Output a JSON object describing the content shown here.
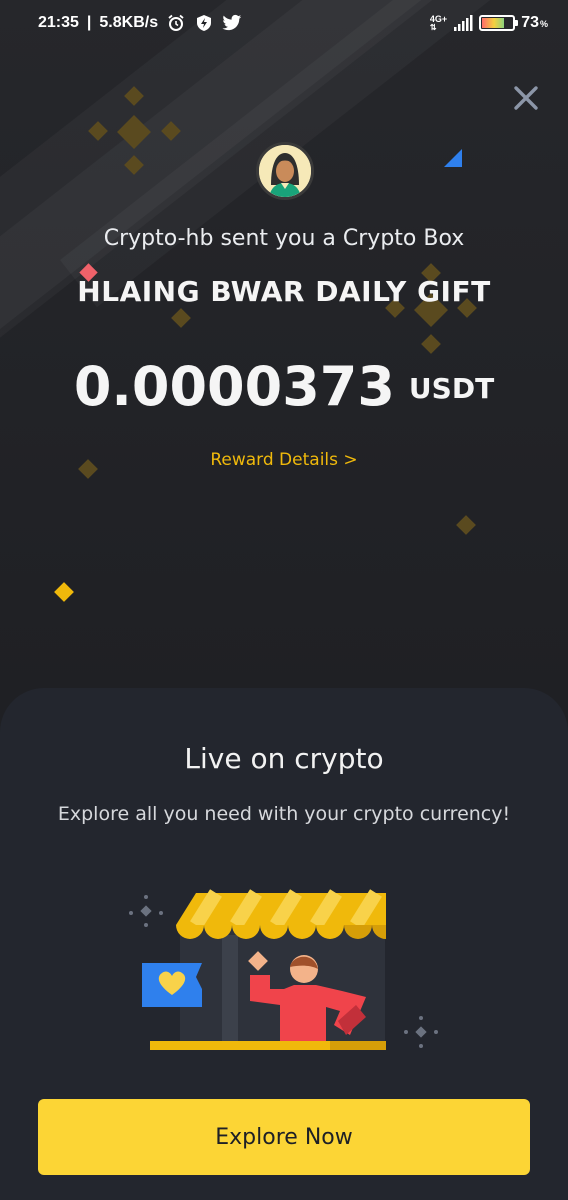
{
  "status_bar": {
    "time": "21:35",
    "net_speed": "5.8KB/s",
    "network_type": "4G+",
    "battery_percent": "73",
    "battery_unit": "%",
    "icons": [
      "alarm-icon",
      "shield-bolt-icon",
      "twitter-icon",
      "signal-icon",
      "battery-icon"
    ]
  },
  "gift": {
    "sender_text": "Crypto-hb sent you a Crypto Box",
    "title": "HLAING BWAR DAILY GIFT",
    "amount": "0.0000373",
    "currency": "USDT",
    "reward_link": "Reward Details >"
  },
  "panel": {
    "title": "Live on crypto",
    "subtitle": "Explore all you need with your crypto currency!",
    "cta_label": "Explore Now"
  },
  "colors": {
    "accent": "#f0b90b",
    "button": "#fcd535",
    "background": "#1f2024",
    "panel": "#23262e"
  }
}
